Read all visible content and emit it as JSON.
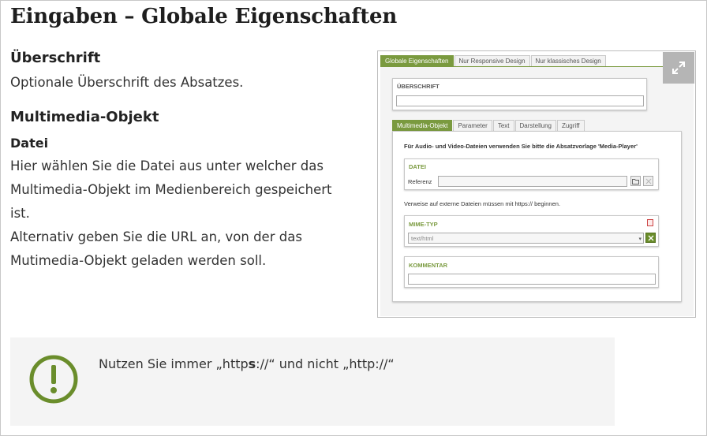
{
  "page": {
    "title": "Eingaben – Globale Eigenschaften"
  },
  "section_heading": {
    "title": "Überschrift",
    "text": "Optionale Überschrift des Absatzes."
  },
  "section_multimedia": {
    "title": "Multimedia-Objekt",
    "subtitle": "Datei",
    "lines": [
      "Hier wählen Sie die Datei aus unter welcher das",
      "Multimedia-Objekt im Medienbereich gespeichert",
      "ist.",
      "Alternativ geben Sie die URL an, von der das",
      "Mutimedia-Objekt geladen werden soll."
    ]
  },
  "screenshot": {
    "top_tabs": [
      "Globale Eigenschaften",
      "Nur Responsive Design",
      "Nur klassisches Design"
    ],
    "ueberschrift_label": "ÜBERSCHRIFT",
    "sub_tabs": [
      "Multimedia-Objekt",
      "Parameter",
      "Text",
      "Darstellung",
      "Zugriff"
    ],
    "info_text": "Für Audio- und Video-Dateien verwenden Sie bitte die Absatzvorlage 'Media-Player'",
    "datei_label": "DATEI",
    "referenz_label": "Referenz",
    "extern_note": "Verweise auf externe Dateien müssen mit https:// beginnen.",
    "mime_label": "MIME-TYP",
    "mime_value": "text/html",
    "kommentar_label": "KOMMENTAR"
  },
  "notice": {
    "text_prefix": "Nutzen Sie immer „http",
    "text_bold": "s",
    "text_suffix": "://“ und nicht „http://“"
  },
  "colors": {
    "accent": "#7a9a3f",
    "notice_bg": "#f4f4f4",
    "icon": "#6a8d2b"
  }
}
